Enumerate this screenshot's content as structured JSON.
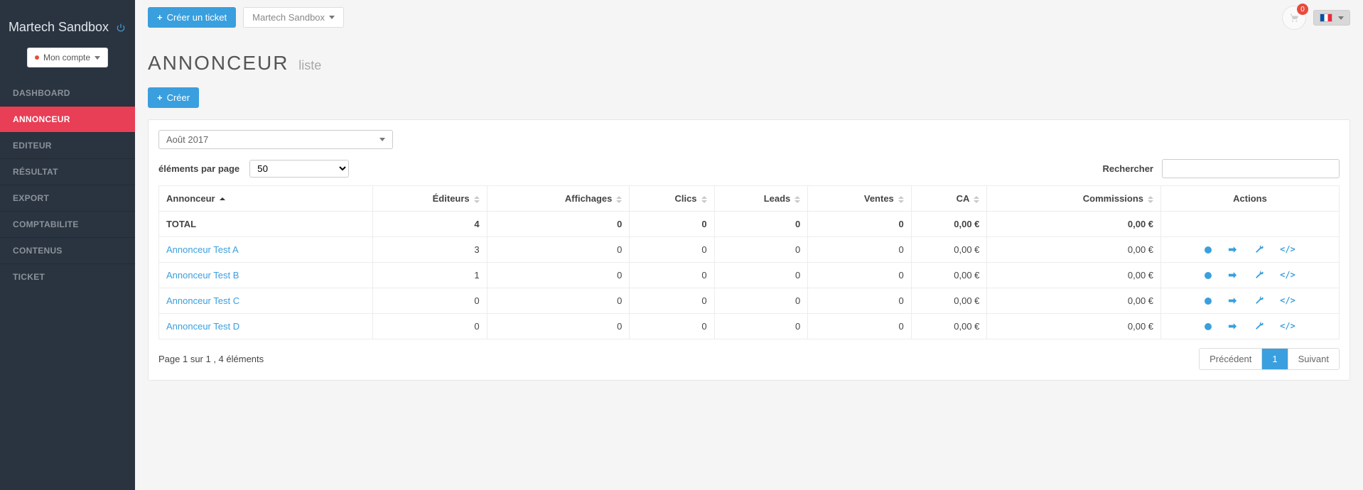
{
  "brand": "Martech Sandbox",
  "account_label": "Mon compte",
  "nav": {
    "dashboard": "DASHBOARD",
    "annonceur": "ANNONCEUR",
    "editeur": "EDITEUR",
    "resultat": "RÉSULTAT",
    "export": "EXPORT",
    "comptabilite": "COMPTABILITE",
    "contenus": "CONTENUS",
    "ticket": "TICKET"
  },
  "topbar": {
    "create_ticket": "Créer un ticket",
    "org_dropdown": "Martech Sandbox",
    "notif_count": "0"
  },
  "page": {
    "title": "ANNONCEUR",
    "subtitle": "liste",
    "create_btn": "Créer"
  },
  "filters": {
    "date": "Août 2017",
    "per_page_label": "éléments par page",
    "per_page_value": "50",
    "search_label": "Rechercher"
  },
  "table": {
    "headers": {
      "annonceur": "Annonceur",
      "editeurs": "Éditeurs",
      "affichages": "Affichages",
      "clics": "Clics",
      "leads": "Leads",
      "ventes": "Ventes",
      "ca": "CA",
      "commissions": "Commissions",
      "actions": "Actions"
    },
    "total_label": "TOTAL",
    "total": {
      "editeurs": "4",
      "affichages": "0",
      "clics": "0",
      "leads": "0",
      "ventes": "0",
      "ca": "0,00 €",
      "commissions": "0,00 €"
    },
    "rows": [
      {
        "name": "Annonceur Test A",
        "editeurs": "3",
        "affichages": "0",
        "clics": "0",
        "leads": "0",
        "ventes": "0",
        "ca": "0,00 €",
        "commissions": "0,00 €"
      },
      {
        "name": "Annonceur Test B",
        "editeurs": "1",
        "affichages": "0",
        "clics": "0",
        "leads": "0",
        "ventes": "0",
        "ca": "0,00 €",
        "commissions": "0,00 €"
      },
      {
        "name": "Annonceur Test C",
        "editeurs": "0",
        "affichages": "0",
        "clics": "0",
        "leads": "0",
        "ventes": "0",
        "ca": "0,00 €",
        "commissions": "0,00 €"
      },
      {
        "name": "Annonceur Test D",
        "editeurs": "0",
        "affichages": "0",
        "clics": "0",
        "leads": "0",
        "ventes": "0",
        "ca": "0,00 €",
        "commissions": "0,00 €"
      }
    ]
  },
  "footer": {
    "info": "Page 1 sur 1 , 4 éléments",
    "prev": "Précédent",
    "page": "1",
    "next": "Suivant"
  }
}
